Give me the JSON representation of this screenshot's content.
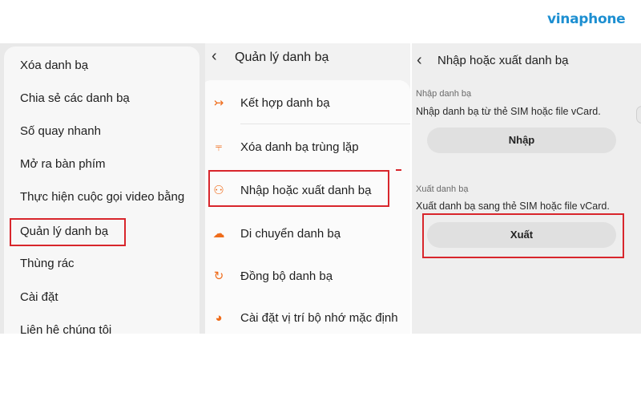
{
  "brand": {
    "name": "vinaphone",
    "color": "#1d8fd1"
  },
  "left_menu": {
    "items": [
      "Xóa danh bạ",
      "Chia sẻ các danh bạ",
      "Số quay nhanh",
      "Mở ra bàn phím",
      "Thực hiện cuộc gọi video bằng",
      "Quản lý danh bạ",
      "Thùng rác",
      "Cài đặt",
      "Liên hệ chúng tôi"
    ],
    "highlighted_index": 5
  },
  "manage_screen": {
    "title": "Quản lý danh bạ",
    "items": [
      {
        "label": "Kết hợp danh bạ",
        "icon": "merge-icon"
      },
      {
        "label": "Xóa danh bạ trùng lặp",
        "icon": "duplicate-remove-icon"
      },
      {
        "label": "Nhập hoặc xuất danh bạ",
        "icon": "import-export-icon"
      },
      {
        "label": "Di chuyển danh bạ",
        "icon": "cloud-move-icon"
      },
      {
        "label": "Đồng bộ danh bạ",
        "icon": "sync-icon"
      },
      {
        "label": "Cài đặt vị trí bộ nhớ mặc định",
        "icon": "storage-location-icon"
      }
    ],
    "highlighted_index": 2
  },
  "import_export_screen": {
    "title": "Nhập hoặc xuất danh bạ",
    "import": {
      "label": "Nhập danh bạ",
      "description": "Nhập danh bạ từ thẻ SIM hoặc file vCard.",
      "button": "Nhập"
    },
    "export": {
      "label": "Xuất danh bạ",
      "description": "Xuất danh bạ sang thẻ SIM hoặc file vCard.",
      "button": "Xuất"
    },
    "highlighted": "export_button"
  },
  "colors": {
    "highlight": "#d8262c",
    "icon_accent": "#ef6c1b"
  }
}
